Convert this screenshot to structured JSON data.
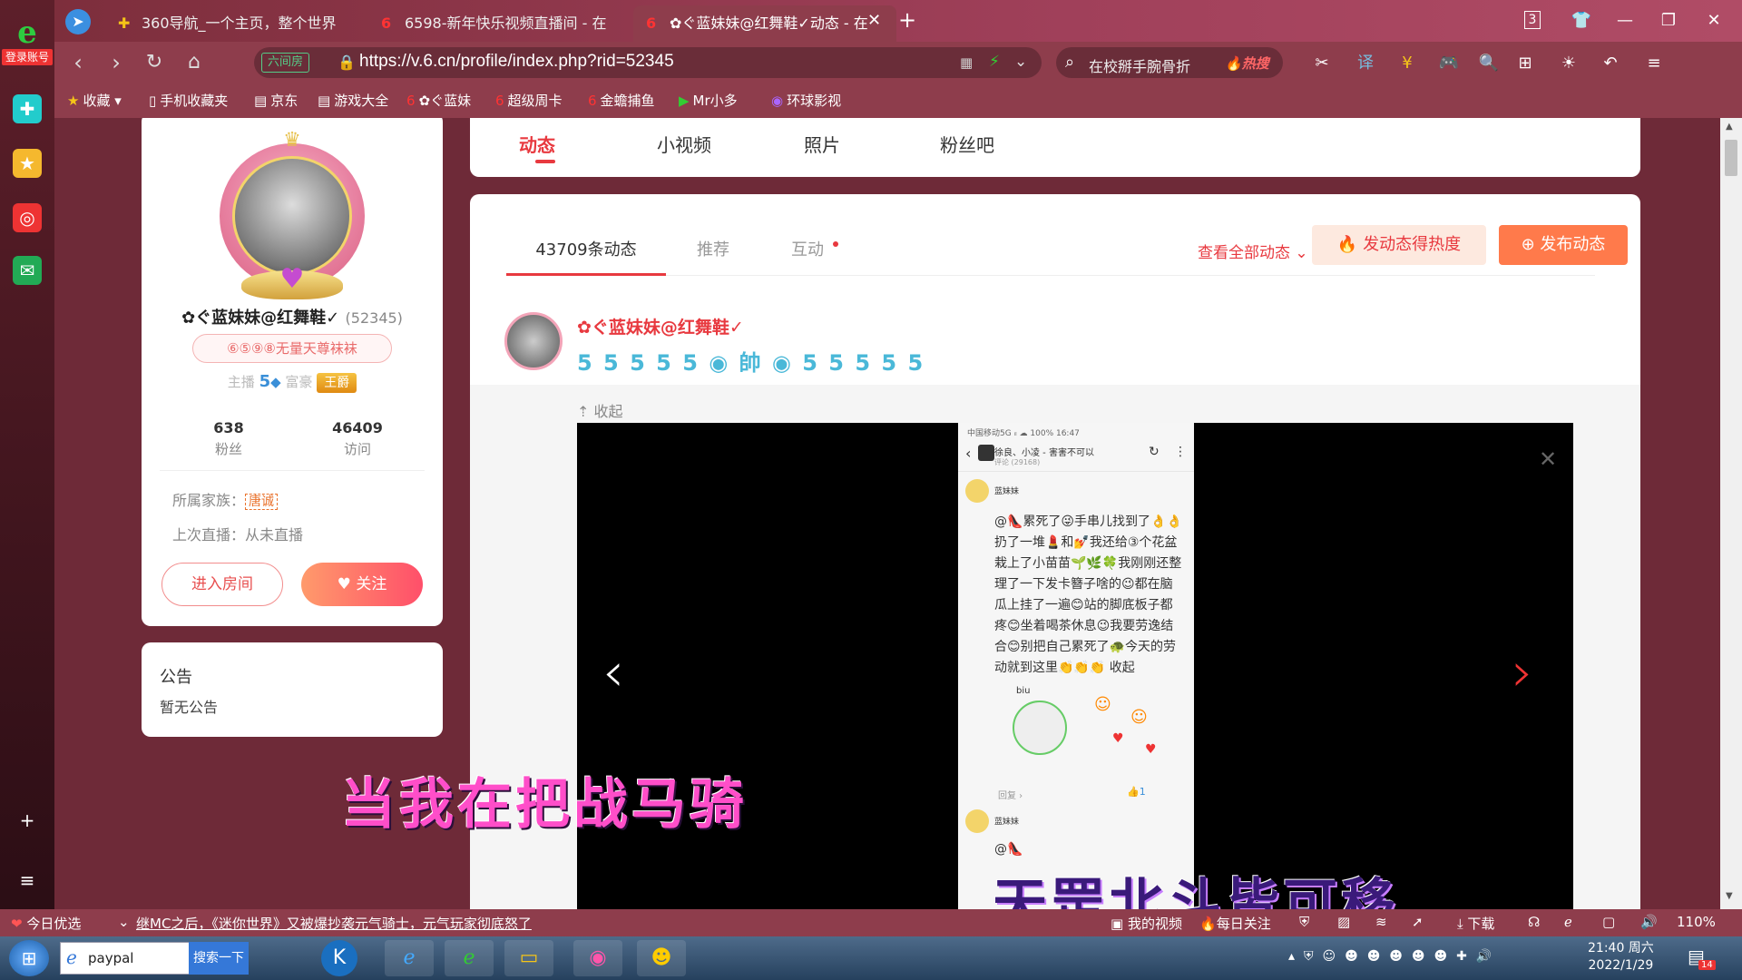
{
  "sidebar": {
    "login_label": "登录账号",
    "logo_glyph": "e"
  },
  "tabs": [
    {
      "label": "360导航_一个主页，整个世界",
      "icon": "360-icon"
    },
    {
      "label": "6598-新年快乐视频直播间 - 在",
      "icon": "six-icon"
    },
    {
      "label": "✿ぐ蓝妹妹@红舞鞋✓动态 - 在",
      "icon": "six-icon",
      "active": true
    }
  ],
  "tab_counter": "3",
  "address": {
    "badge": "六间房",
    "url": "https://v.6.cn/profile/index.php?rid=52345"
  },
  "search": {
    "placeholder": "在校掰手腕骨折",
    "hot": "🔥热搜"
  },
  "bookmarks": [
    "收藏",
    "手机收藏夹",
    "京东",
    "游戏大全",
    "✿ぐ蓝妹",
    "超级周卡",
    "金蟾捕鱼",
    "Mr小多",
    "环球影视"
  ],
  "profile": {
    "name": "✿ぐ蓝妹妹@红舞鞋✓",
    "rid": "(52345)",
    "title_badge": "⑥⑤⑨⑧无量天尊袜袜",
    "anchor_label": "主播",
    "anchor_level": "5",
    "rich_label": "富豪",
    "rich_rank": "王爵",
    "fans_count": "638",
    "fans_label": "粉丝",
    "visits_count": "46409",
    "visits_label": "访问",
    "family_label": "所属家族：",
    "family_name": "唐诚",
    "last_live": "上次直播：从未直播",
    "enter_room": "进入房间",
    "follow": "关注"
  },
  "notice": {
    "title": "公告",
    "text": "暂无公告"
  },
  "profile_tabs": [
    "动态",
    "小视频",
    "照片",
    "粉丝吧"
  ],
  "feed": {
    "tabs": [
      "43709条动态",
      "推荐",
      "互动"
    ],
    "view_all": "查看全部动态",
    "heat_button": "发动态得热度",
    "post_button": "发布动态",
    "post_author": "✿ぐ蓝妹妹@红舞鞋✓",
    "medals": "5 5 5 5 5 ◉ 帥 ◉ 5 5 5 5 5",
    "collapse": "收起"
  },
  "phone": {
    "status": "中国移动5G ᵢₗ ☁ 100% 16:47",
    "title": "徐良、小凌 - 害害不可以",
    "subtitle": "评论 (29168)",
    "user": "蓝妹妹",
    "text": "@👠累死了😜手串儿找到了👌👌扔了一堆💄和💅我还给③个花盆栽上了小苗苗🌱🌿🍀我刚刚还整理了一下发卡簪子啥的😉都在脑瓜上挂了一遍😊站的脚底板子都疼😊坐着喝茶休息😉我要劳逸结合😊别把自己累死了🐢今天的劳动就到这里👏👏👏 收起",
    "reply": "回复 ›",
    "user2": "蓝妹妹",
    "at": "@👠",
    "sticker_label": "biu"
  },
  "lyrics": {
    "line1": "当我在把战马骑",
    "line2": "天罡北斗皆可移"
  },
  "status": {
    "today": "今日优选",
    "news": "继MC之后，《迷你世界》又被爆抄袭元气骑士，元气玩家彻底怒了",
    "my_video": "我的视频",
    "daily": "每日关注",
    "download": "下载",
    "zoom": "110%"
  },
  "taskbar": {
    "search_text": "paypal",
    "search_btn": "搜索一下",
    "time": "21:40 周六",
    "date": "2022/1/29",
    "badge": "14"
  }
}
